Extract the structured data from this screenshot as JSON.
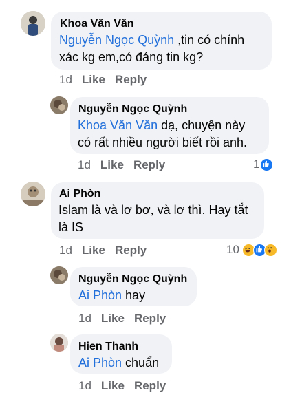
{
  "comments": [
    {
      "author": "Khoa Văn Văn",
      "mention": "Nguyễn Ngọc Quỳnh",
      "text_line1": " ,tin có chính",
      "text_line2": "xác kg em,có đáng tin kg?",
      "time": "1d",
      "like": "Like",
      "reply": "Reply"
    },
    {
      "author": "Nguyễn Ngọc Quỳnh",
      "mention": "Khoa Văn Văn",
      "text_line1": " dạ, chuyện này",
      "text_line2": "có rất nhiều người biết rồi anh.",
      "time": "1d",
      "like": "Like",
      "reply": "Reply",
      "reaction_count": "1",
      "reactions": [
        "like-icon"
      ]
    },
    {
      "author": "Ai Phòn",
      "text_line1": "Islam là và lơ bơ, và lơ thì. Hay tắt",
      "text_line2": "là IS",
      "time": "1d",
      "like": "Like",
      "reply": "Reply",
      "reaction_count": "10",
      "reactions": [
        "haha-icon",
        "like-icon",
        "wow-icon"
      ]
    },
    {
      "author": "Nguyễn Ngọc Quỳnh",
      "mention": "Ai Phòn",
      "text_line1": " hay",
      "time": "1d",
      "like": "Like",
      "reply": "Reply"
    },
    {
      "author": "Hien Thanh",
      "mention": "Ai Phòn",
      "text_line1": " chuẩn",
      "time": "1d",
      "like": "Like",
      "reply": "Reply"
    }
  ],
  "colors": {
    "bubble": "#f0f2f5",
    "mention": "#216fdb",
    "meta": "#65676b",
    "like_blue": "#1877f2",
    "haha_yellow": "#f7b928"
  }
}
